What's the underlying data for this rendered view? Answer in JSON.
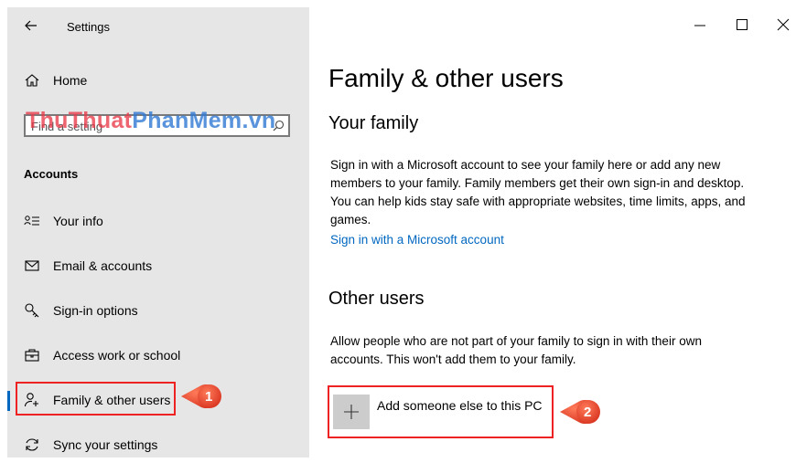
{
  "window": {
    "title": "Settings",
    "controls": [
      "minimize-icon",
      "maximize-icon",
      "close-icon"
    ]
  },
  "sidebar": {
    "home": {
      "label": "Home",
      "icon": "home-icon"
    },
    "search": {
      "placeholder": "Find a setting",
      "icon": "search-icon"
    },
    "watermark": {
      "part1": "ThuThuat",
      "part2": "PhanMem.vn"
    },
    "section_title": "Accounts",
    "items": [
      {
        "label": "Your info",
        "icon": "person-lines-icon"
      },
      {
        "label": "Email & accounts",
        "icon": "mail-icon"
      },
      {
        "label": "Sign-in options",
        "icon": "key-icon"
      },
      {
        "label": "Access work or school",
        "icon": "briefcase-icon"
      },
      {
        "label": "Family & other users",
        "icon": "person-add-icon",
        "active": true
      },
      {
        "label": "Sync your settings",
        "icon": "sync-icon"
      }
    ]
  },
  "callouts": {
    "first": "1",
    "second": "2"
  },
  "main": {
    "title": "Family & other users",
    "your_family": {
      "heading": "Your family",
      "description": "Sign in with a Microsoft account to see your family here or add any new members to your family. Family members get their own sign-in and desktop. You can help kids stay safe with appropriate websites, time limits, apps, and games.",
      "link": "Sign in with a Microsoft account"
    },
    "other_users": {
      "heading": "Other users",
      "description": "Allow people who are not part of your family to sign in with their own accounts. This won't add them to your family.",
      "add_button": "Add someone else to this PC"
    }
  },
  "colors": {
    "accent": "#0067c0",
    "sidebar_bg": "#e6e6e6",
    "highlight_red": "#e22222"
  }
}
